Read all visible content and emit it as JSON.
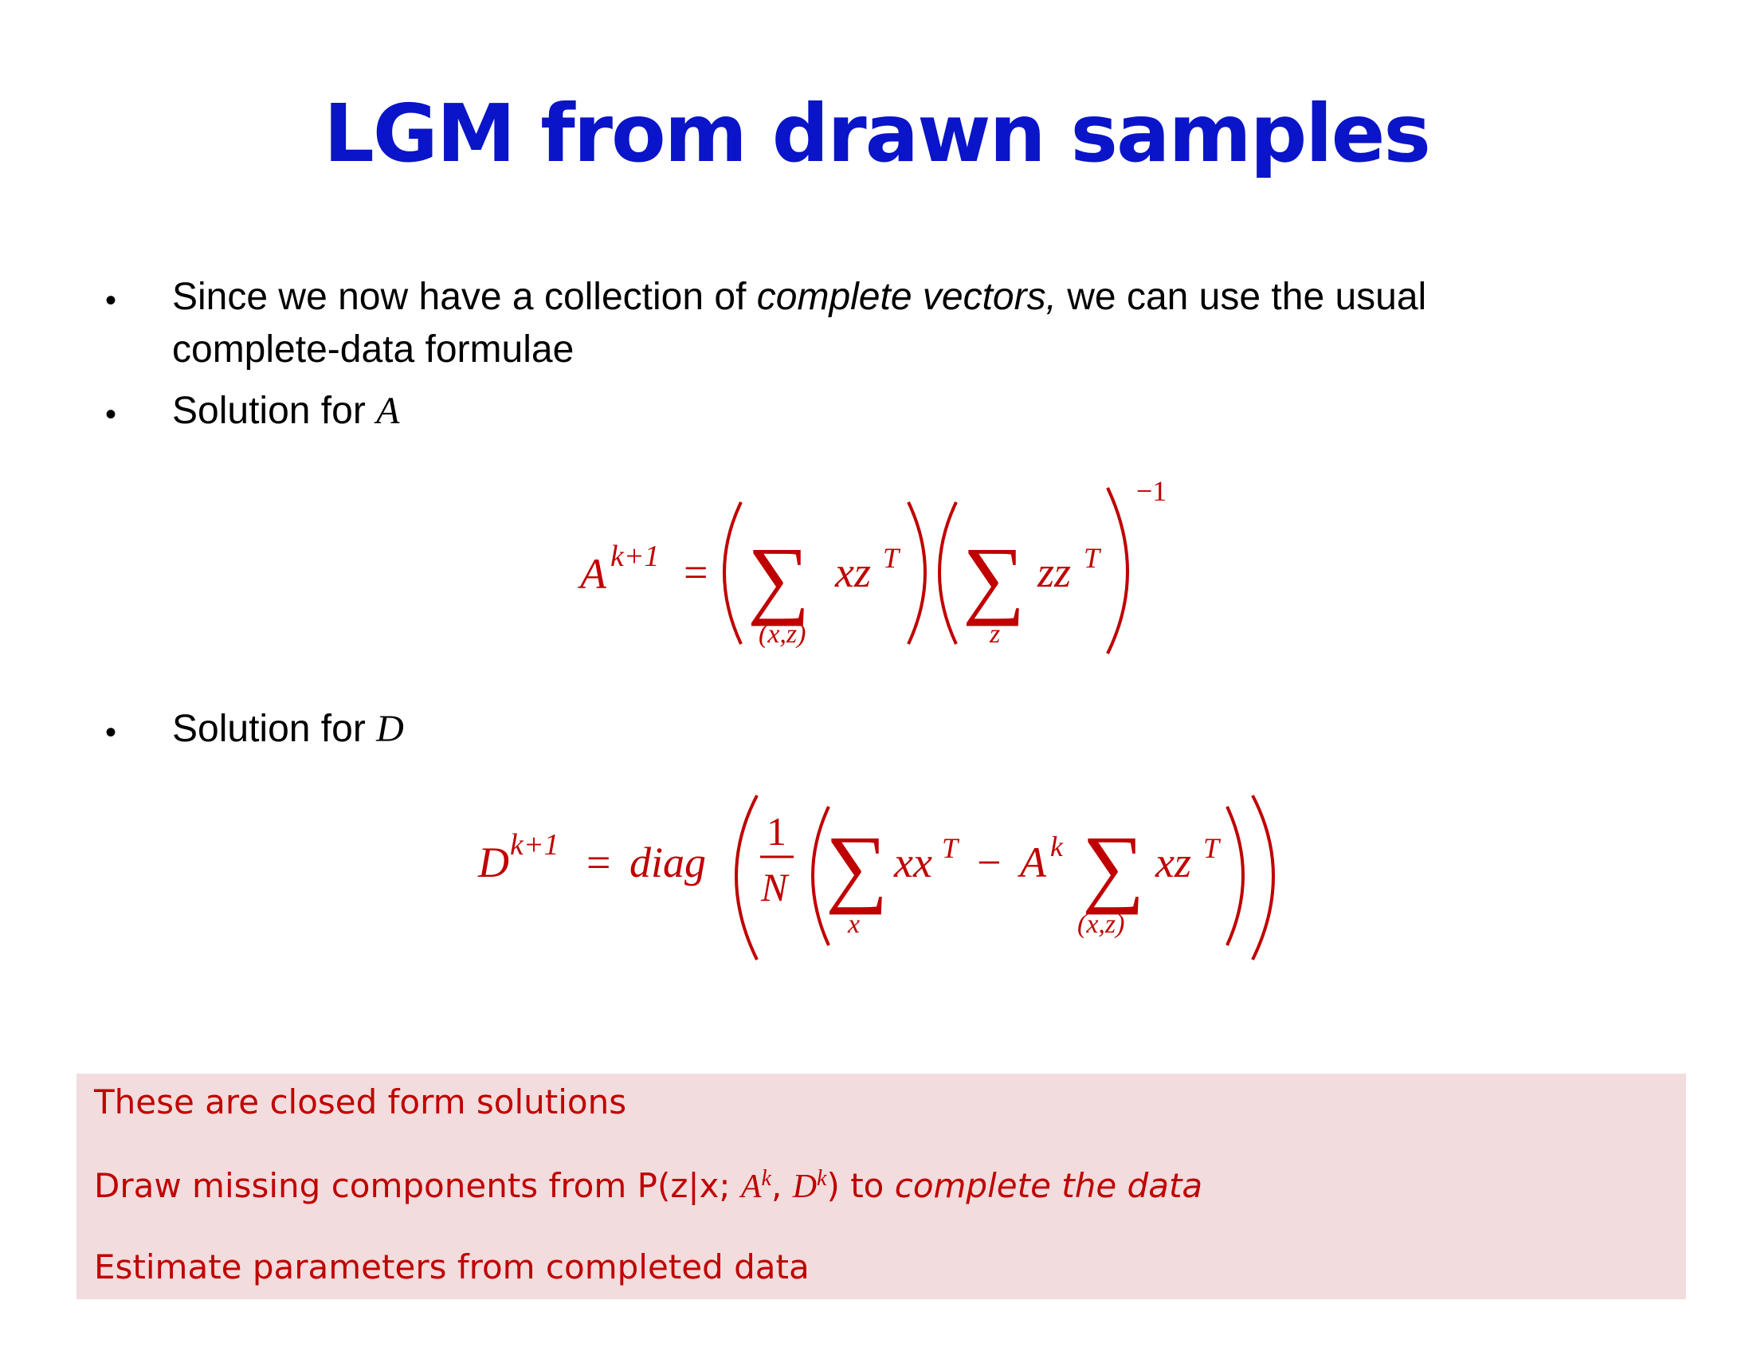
{
  "title": "LGM from drawn samples",
  "bullets": [
    {
      "pre": "Since we now have a collection of ",
      "em": "complete vectors,",
      "post": " we can use the usual complete-data formulae"
    },
    {
      "text": "Solution for ",
      "symbol": "A"
    },
    {
      "text": "Solution for ",
      "symbol": "D"
    }
  ],
  "equation_A": {
    "lhs": "A",
    "lhs_sup": "k+1",
    "equals": "=",
    "sum1_sub": "(x,z)",
    "term1": "xz",
    "term1_sup": "T",
    "sum2_sub": "z",
    "term2": "zz",
    "term2_sup": "T",
    "outer_sup": "−1"
  },
  "equation_D": {
    "lhs": "D",
    "lhs_sup": "k+1",
    "equals": "=",
    "func": "diag",
    "frac_num": "1",
    "frac_den": "N",
    "sum1_sub": "x",
    "term1": "xx",
    "term1_sup": "T",
    "minus": "−",
    "ak": "A",
    "ak_sup": "k",
    "sum2_sub": "(x,z)",
    "term2": "xz",
    "term2_sup": "T"
  },
  "notes": {
    "line1": "These are closed form solutions",
    "line2_pre": "Draw missing components from P(z|x; ",
    "line2_a": "A",
    "line2_a_sup": "k",
    "line2_sep": ", ",
    "line2_d": "D",
    "line2_d_sup": "k",
    "line2_mid": ") to ",
    "line2_em": "complete the data",
    "line3": "Estimate parameters from completed data"
  },
  "colors": {
    "title": "#0a14c8",
    "equation": "#c00000",
    "note_bg": "#f2dcdd",
    "note_text": "#c00000"
  }
}
